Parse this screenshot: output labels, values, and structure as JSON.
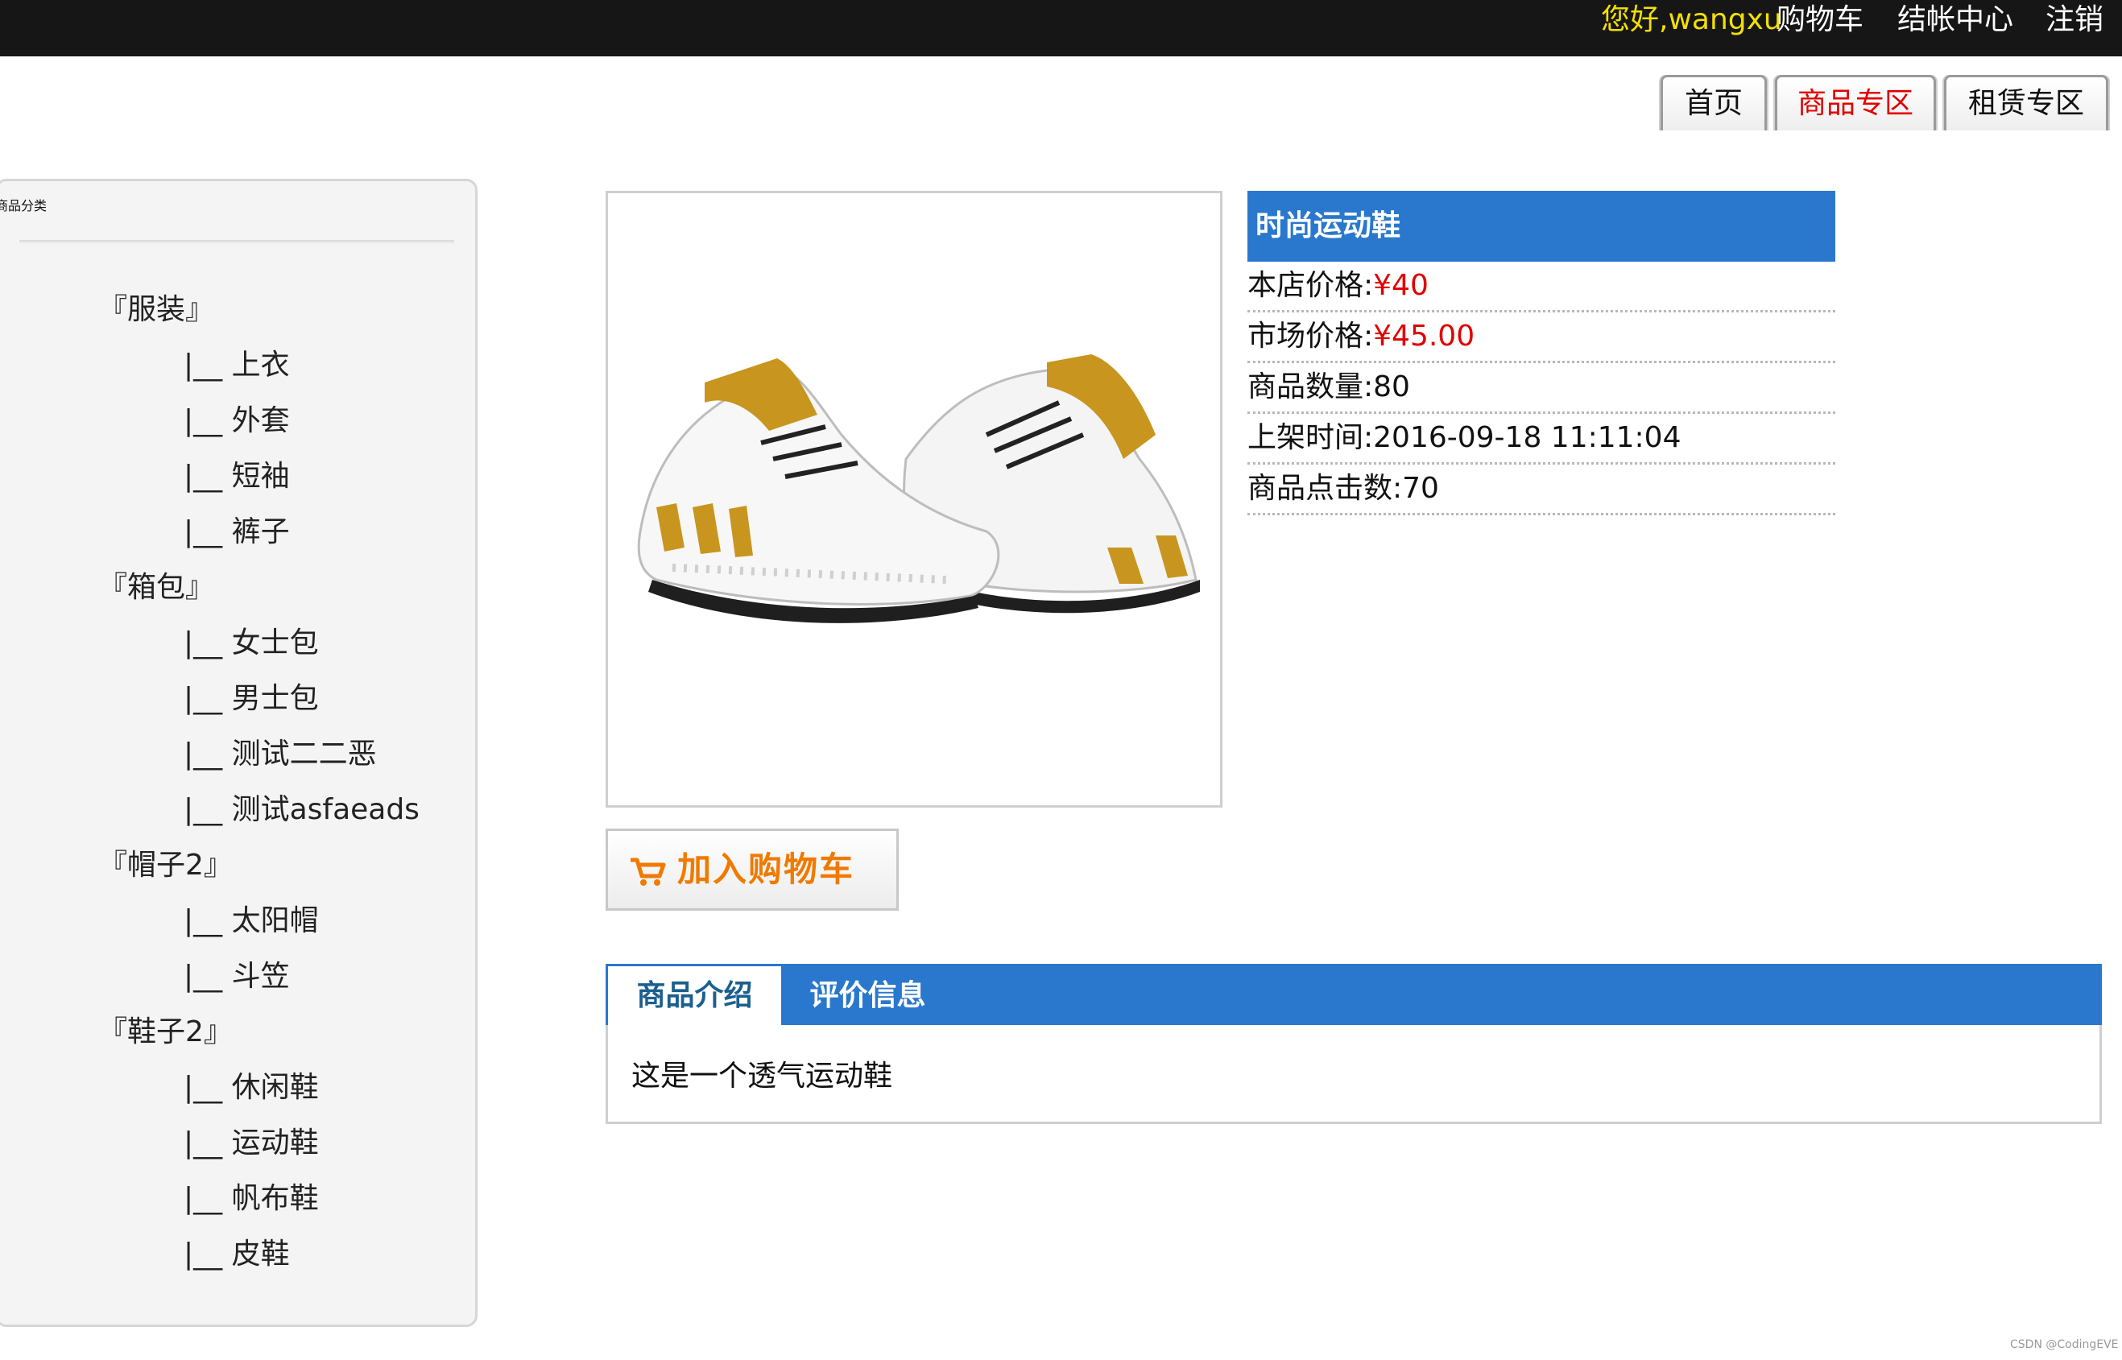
{
  "topbar": {
    "greeting": "您好,wangxu",
    "links": [
      "购物车",
      "结帐中心",
      "注销"
    ]
  },
  "nav": {
    "tabs": [
      "首页",
      "商品专区",
      "租赁专区"
    ],
    "active": "商品专区"
  },
  "sidebar": {
    "title": "商品分类",
    "categories": [
      {
        "name": "『服装』",
        "children": [
          "|__ 上衣",
          "|__ 外套",
          "|__ 短袖",
          "|__ 裤子"
        ]
      },
      {
        "name": "『箱包』",
        "children": [
          "|__ 女士包",
          "|__ 男士包",
          "|__ 测试二二恶",
          "|__ 测试asfaeads"
        ]
      },
      {
        "name": "『帽子2』",
        "children": [
          "|__ 太阳帽",
          "|__ 斗笠"
        ]
      },
      {
        "name": "『鞋子2』",
        "children": [
          "|__ 休闲鞋",
          "|__ 运动鞋",
          "|__ 帆布鞋",
          "|__ 皮鞋"
        ]
      }
    ]
  },
  "product": {
    "image_icon": "sneaker-image",
    "title": "时尚运动鞋",
    "rows": [
      {
        "label": "本店价格:",
        "value": "¥40"
      },
      {
        "label": "市场价格:",
        "value": "¥45.00"
      },
      {
        "label": "商品数量:",
        "value": "80"
      },
      {
        "label": "上架时间:",
        "value": "2016-09-18 11:11:04"
      },
      {
        "label": "商品点击数:",
        "value": "70"
      }
    ],
    "cart_button": "加入购物车",
    "cart_icon": "cart-icon"
  },
  "detail_tabs": {
    "tabs": [
      "商品介绍",
      "评价信息"
    ],
    "active": "商品介绍",
    "description": "这是一个透气运动鞋"
  },
  "watermark": "CSDN @CodingEVE",
  "colors": {
    "topbar": "#161616",
    "greeting": "#f3e000",
    "accent_blue": "#2a78cd",
    "price_red": "#e10000",
    "cart_orange": "#f07a00",
    "sidebar_title": "#1b5f8e"
  }
}
